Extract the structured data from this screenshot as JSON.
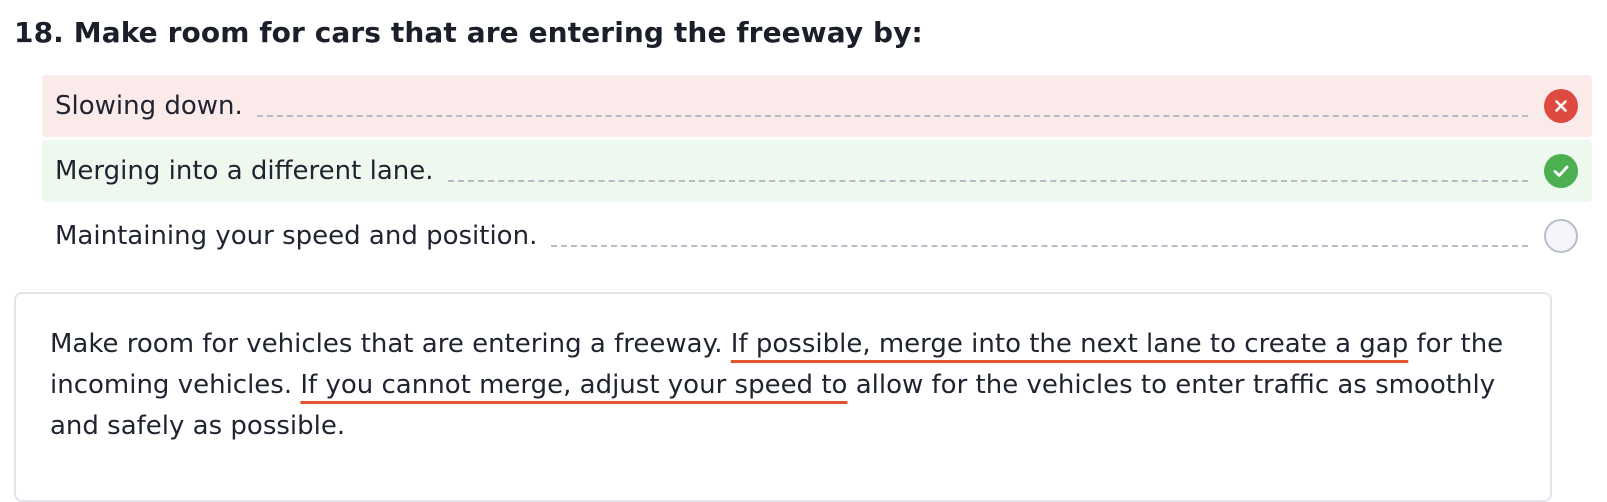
{
  "question": {
    "title": "18. Make room for cars that are entering the freeway by:"
  },
  "answers": [
    {
      "text": "Slowing down.",
      "status": "wrong",
      "status_icon": "x-circle-icon"
    },
    {
      "text": "Merging into a different lane.",
      "status": "correct",
      "status_icon": "check-circle-icon"
    },
    {
      "text": "Maintaining your speed and position.",
      "status": "unselected",
      "status_icon": "empty-radio-icon"
    }
  ],
  "explanation": {
    "part1": "Make room for vehicles that are entering a freeway. ",
    "highlight1": "If possible, merge into the next lane to create a gap",
    "part2": " for the incoming vehicles. ",
    "highlight2": "If you cannot merge, adjust your speed to",
    "part3": " allow for the vehicles to enter traffic as smoothly and safely as possible."
  },
  "colors": {
    "wrong_bg": "#fbeaea",
    "correct_bg": "#edf8ee",
    "wrong_icon": "#de4a3f",
    "correct_icon": "#4caf50",
    "highlight_underline": "#e0542e"
  }
}
